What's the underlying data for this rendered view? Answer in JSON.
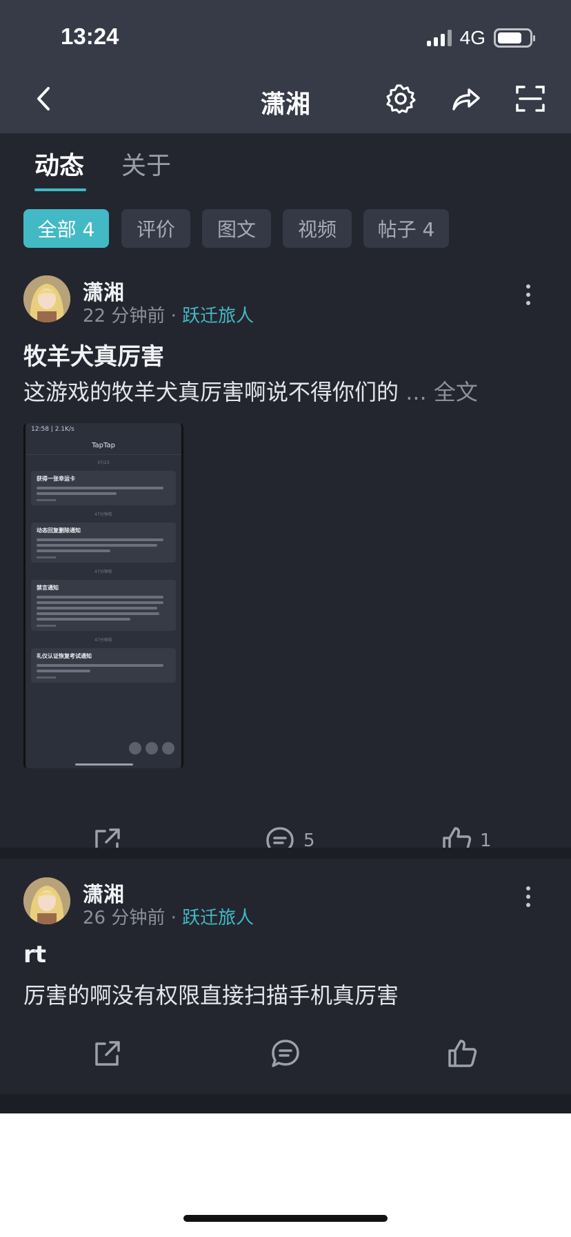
{
  "status": {
    "time": "13:24",
    "network": "4G"
  },
  "nav": {
    "title": "潇湘"
  },
  "tabs": [
    {
      "label": "动态"
    },
    {
      "label": "关于"
    }
  ],
  "filters": [
    {
      "label": "全部 4"
    },
    {
      "label": "评价"
    },
    {
      "label": "图文"
    },
    {
      "label": "视频"
    },
    {
      "label": "帖子 4"
    }
  ],
  "posts": [
    {
      "author": "潇湘",
      "time": "22 分钟前",
      "sep": "·",
      "role": "跃迁旅人",
      "title": "牧羊犬真厉害",
      "body": "这游戏的牧羊犬真厉害啊说不得你们的",
      "readmore": "... 全文",
      "comments": "5",
      "likes": "1",
      "screenshot": {
        "status": "12:58 | 2.1K/s",
        "header": "TapTap",
        "cards": [
          {
            "title": "获得一张幸运卡"
          },
          {
            "title": "动态回复删除通知"
          },
          {
            "title": "禁言通知"
          },
          {
            "title": "礼仪认证恢复考试通知"
          }
        ],
        "seps": [
          "07/23",
          "47分钟前",
          "47分钟前",
          "47分钟前"
        ]
      }
    },
    {
      "author": "潇湘",
      "time": "26 分钟前",
      "sep": "·",
      "role": "跃迁旅人",
      "title": "rt",
      "body": "厉害的啊没有权限直接扫描手机真厉害"
    }
  ],
  "colors": {
    "accent": "#43b9c5",
    "background": "#24262f",
    "header": "#363b47"
  }
}
